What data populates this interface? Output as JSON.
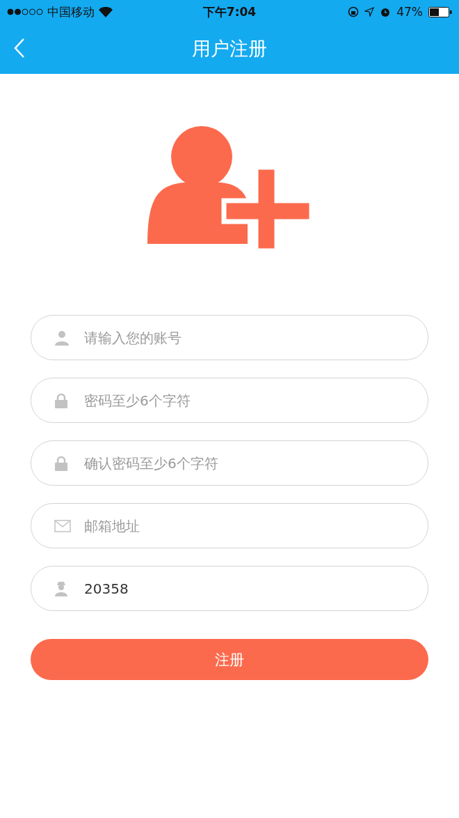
{
  "status_bar": {
    "carrier": "中国移动",
    "time": "下午7:04",
    "battery": "47%"
  },
  "nav": {
    "title": "用户注册"
  },
  "fields": [
    {
      "kind": "user",
      "placeholder": "请输入您的账号"
    },
    {
      "kind": "lock",
      "placeholder": "密码至少6个字符"
    },
    {
      "kind": "lock",
      "placeholder": "确认密码至少6个字符"
    },
    {
      "kind": "mail",
      "placeholder": "邮箱地址"
    },
    {
      "kind": "agent",
      "value": "20358"
    }
  ],
  "submit": {
    "label": "注册"
  }
}
